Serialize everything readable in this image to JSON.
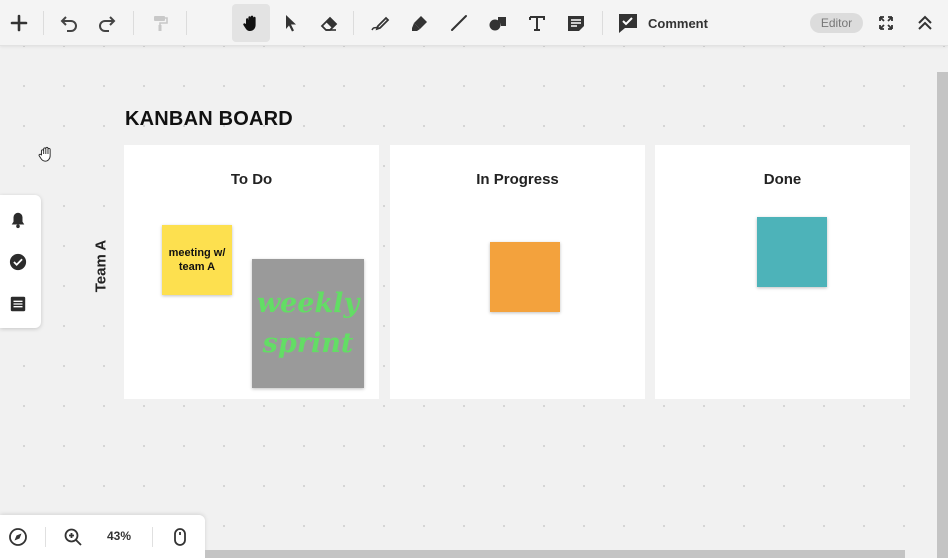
{
  "toolbar": {
    "comment_label": "Comment",
    "mode_badge": "Editor",
    "tools": [
      {
        "name": "add-icon"
      },
      {
        "name": "undo-icon"
      },
      {
        "name": "redo-icon"
      },
      {
        "name": "format-painter-icon"
      },
      {
        "name": "hand-icon",
        "active": true
      },
      {
        "name": "select-arrow-icon"
      },
      {
        "name": "eraser-icon"
      },
      {
        "name": "pen-icon"
      },
      {
        "name": "highlighter-icon"
      },
      {
        "name": "line-icon"
      },
      {
        "name": "shapes-icon"
      },
      {
        "name": "text-icon"
      },
      {
        "name": "sticky-note-icon"
      },
      {
        "name": "comment-icon"
      },
      {
        "name": "fullscreen-icon"
      },
      {
        "name": "collapse-icon"
      }
    ]
  },
  "side_panel": {
    "items": [
      {
        "name": "notifications-bell-icon"
      },
      {
        "name": "check-circle-icon"
      },
      {
        "name": "list-icon"
      }
    ]
  },
  "board": {
    "title": "KANBAN BOARD",
    "row_label": "Team A",
    "columns": [
      {
        "title": "To Do"
      },
      {
        "title": "In Progress"
      },
      {
        "title": "Done"
      }
    ],
    "stickies": [
      {
        "text": "meeting w/ team A",
        "color": "#fde04f",
        "column": "To Do"
      },
      {
        "text": "weekly sprint",
        "color": "#9a9a9a",
        "text_color": "#63dd65",
        "column": "To Do"
      },
      {
        "text": "",
        "color": "#f3a23d",
        "column": "In Progress"
      },
      {
        "text": "",
        "color": "#4db3b9",
        "column": "Done"
      }
    ]
  },
  "zoom": {
    "level": "43%",
    "icons": [
      "compass-icon",
      "zoom-in-icon",
      "mouse-icon"
    ]
  },
  "colors": {
    "canvas": "#f1f1f1",
    "toolbar": "#f4f4f4",
    "active_tool": "#e3e3e3"
  }
}
